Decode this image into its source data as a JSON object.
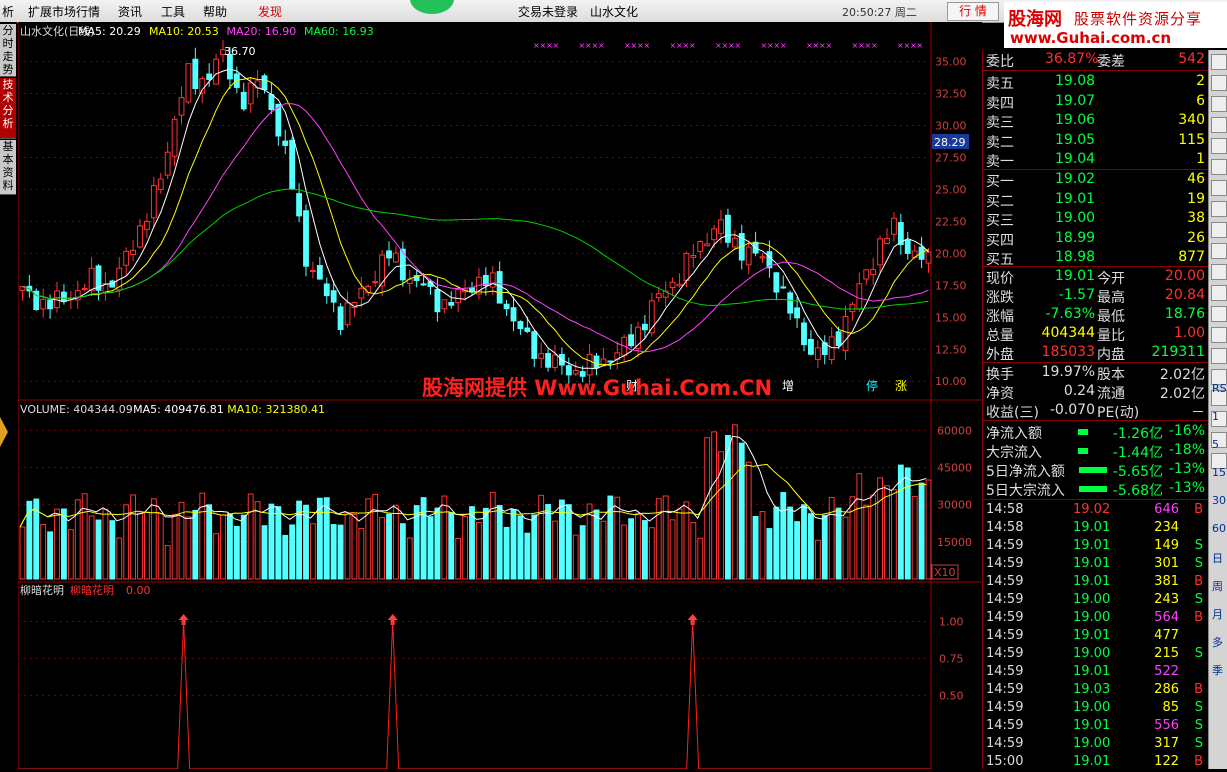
{
  "menubar": {
    "items": [
      "析",
      "扩展市场行情",
      "资讯",
      "工具",
      "帮助",
      "发现"
    ],
    "login_status": "交易未登录",
    "stock_name": "山水文化",
    "clock": "20:50:27 周二",
    "quote_button": "行 情"
  },
  "brand": {
    "site": "股海网",
    "slogan": "股票软件资源分享",
    "url": "www.Guhai.com.cn"
  },
  "left_tabs": [
    "分时走势",
    "技术分析",
    "基本资料"
  ],
  "watermark": "股海网提供 Www.Guhai.Com.CN",
  "main_chart": {
    "legend": {
      "name": "山水文化(日线)",
      "ma5": "MA5: 20.29",
      "ma10": "MA10: 20.53",
      "ma20": "MA20: 16.90",
      "ma60": "MA60: 16.93"
    },
    "y_ticks": [
      "35.00",
      "32.50",
      "30.00",
      "27.50",
      "25.00",
      "22.50",
      "20.00",
      "17.50",
      "15.00",
      "12.50",
      "10.00"
    ],
    "price_tag": "28.29",
    "peak_label": "36.70",
    "markers": [
      "财",
      "增",
      "停",
      "涨"
    ]
  },
  "volume_chart": {
    "legend": {
      "name": "VOLUME: 404344.09",
      "ma5": "MA5: 409476.81",
      "ma10": "MA10: 321380.41"
    },
    "y_ticks": [
      "60000",
      "45000",
      "30000",
      "15000"
    ],
    "unit": "X10"
  },
  "indicator_chart": {
    "legend": {
      "name": "柳暗花明",
      "sub": "柳暗花明",
      "value": "0.00"
    },
    "y_ticks": [
      "1.00",
      "0.75",
      "0.50"
    ]
  },
  "chart_data": [
    {
      "type": "candlestick",
      "title": "山水文化(日线)",
      "ylim": [
        9,
        37
      ],
      "yticks": [
        10,
        12.5,
        15,
        17.5,
        20,
        22.5,
        25,
        27.5,
        30,
        32.5,
        35
      ],
      "close_path": [
        17,
        16.5,
        16,
        16.2,
        16.8,
        17.2,
        18,
        17.5,
        18,
        20,
        22,
        24,
        26.5,
        31,
        34,
        33,
        34.5,
        35.5,
        33,
        32,
        33.5,
        32,
        29,
        25,
        20,
        18,
        16.5,
        15,
        16,
        17,
        18.5,
        20,
        19,
        18,
        17.5,
        16.5,
        16,
        16.5,
        17.5,
        18,
        17.5,
        16,
        14.5,
        13,
        12,
        11.5,
        11,
        10.8,
        11,
        11.5,
        12,
        12.5,
        13.5,
        15,
        16.5,
        17.5,
        18.5,
        20,
        21,
        22.5,
        21,
        20.5,
        20,
        19.5,
        18,
        16,
        14,
        12.5,
        12,
        13,
        15,
        17,
        19,
        21,
        22,
        20.5,
        20,
        19.2
      ]
    },
    {
      "type": "bar",
      "title": "VOLUME",
      "ylim": [
        0,
        65000
      ],
      "yticks": [
        15000,
        30000,
        45000,
        60000
      ]
    },
    {
      "type": "line",
      "title": "柳暗花明",
      "ylim": [
        0,
        1.2
      ],
      "yticks": [
        0.5,
        0.75,
        1.0
      ],
      "signal_positions": [
        0.18,
        0.41,
        0.74
      ]
    }
  ],
  "right_panel": {
    "weibi": {
      "label": "委比",
      "value": "36.87%",
      "label2": "委差",
      "value2": "542"
    },
    "sell": [
      {
        "label": "卖五",
        "price": "19.08",
        "vol": "2"
      },
      {
        "label": "卖四",
        "price": "19.07",
        "vol": "6"
      },
      {
        "label": "卖三",
        "price": "19.06",
        "vol": "340"
      },
      {
        "label": "卖二",
        "price": "19.05",
        "vol": "115"
      },
      {
        "label": "卖一",
        "price": "19.04",
        "vol": "1"
      }
    ],
    "buy": [
      {
        "label": "买一",
        "price": "19.02",
        "vol": "46"
      },
      {
        "label": "买二",
        "price": "19.01",
        "vol": "19"
      },
      {
        "label": "买三",
        "price": "19.00",
        "vol": "38"
      },
      {
        "label": "买四",
        "price": "18.99",
        "vol": "26"
      },
      {
        "label": "买五",
        "price": "18.98",
        "vol": "877"
      }
    ],
    "stats": [
      {
        "l1": "现价",
        "v1": "19.01",
        "l2": "今开",
        "v2": "20.00",
        "c1": "#00ff40",
        "c2": "#ff3030"
      },
      {
        "l1": "涨跌",
        "v1": "-1.57",
        "l2": "最高",
        "v2": "20.84",
        "c1": "#00ff40",
        "c2": "#ff3030"
      },
      {
        "l1": "涨幅",
        "v1": "-7.63%",
        "l2": "最低",
        "v2": "18.76",
        "c1": "#00ff40",
        "c2": "#00ff40"
      },
      {
        "l1": "总量",
        "v1": "404344",
        "l2": "量比",
        "v2": "1.00",
        "c1": "#ffff00",
        "c2": "#ff3030"
      },
      {
        "l1": "外盘",
        "v1": "185033",
        "l2": "内盘",
        "v2": "219311",
        "c1": "#ff3030",
        "c2": "#00ff40"
      }
    ],
    "stats2": [
      {
        "l1": "换手",
        "v1": "19.97%",
        "l2": "股本",
        "v2": "2.02亿"
      },
      {
        "l1": "净资",
        "v1": "0.24",
        "l2": "流通",
        "v2": "2.02亿"
      },
      {
        "l1": "收益(三)",
        "v1": "-0.070",
        "l2": "PE(动)",
        "v2": "－"
      }
    ],
    "flow": [
      {
        "label": "净流入额",
        "value": "-1.26亿",
        "pct": "-16%",
        "bar": 0.2
      },
      {
        "label": "大宗流入",
        "value": "-1.44亿",
        "pct": "-18%",
        "bar": 0.2
      },
      {
        "label": "5日净流入额",
        "value": "-5.65亿",
        "pct": "-13%",
        "bar": 1.0
      },
      {
        "label": "5日大宗流入",
        "value": "-5.68亿",
        "pct": "-13%",
        "bar": 1.0
      }
    ],
    "ticks": [
      {
        "t": "14:58",
        "p": "19.02",
        "v": "646",
        "d": "B",
        "pc": "#ff3030",
        "vc": "#ff40ff"
      },
      {
        "t": "14:58",
        "p": "19.01",
        "v": "234",
        "d": "",
        "pc": "#00ff40",
        "vc": "#ffff00"
      },
      {
        "t": "14:59",
        "p": "19.01",
        "v": "149",
        "d": "S",
        "pc": "#00ff40",
        "vc": "#ffff00"
      },
      {
        "t": "14:59",
        "p": "19.01",
        "v": "301",
        "d": "S",
        "pc": "#00ff40",
        "vc": "#ffff00"
      },
      {
        "t": "14:59",
        "p": "19.01",
        "v": "381",
        "d": "B",
        "pc": "#00ff40",
        "vc": "#ffff00"
      },
      {
        "t": "14:59",
        "p": "19.00",
        "v": "243",
        "d": "S",
        "pc": "#00ff40",
        "vc": "#ffff00"
      },
      {
        "t": "14:59",
        "p": "19.00",
        "v": "564",
        "d": "B",
        "pc": "#00ff40",
        "vc": "#ff40ff"
      },
      {
        "t": "14:59",
        "p": "19.01",
        "v": "477",
        "d": "",
        "pc": "#00ff40",
        "vc": "#ffff00"
      },
      {
        "t": "14:59",
        "p": "19.00",
        "v": "215",
        "d": "S",
        "pc": "#00ff40",
        "vc": "#ffff00"
      },
      {
        "t": "14:59",
        "p": "19.01",
        "v": "522",
        "d": "",
        "pc": "#00ff40",
        "vc": "#ff40ff"
      },
      {
        "t": "14:59",
        "p": "19.03",
        "v": "286",
        "d": "B",
        "pc": "#00ff40",
        "vc": "#ffff00"
      },
      {
        "t": "14:59",
        "p": "19.00",
        "v": "85",
        "d": "S",
        "pc": "#00ff40",
        "vc": "#ffff00"
      },
      {
        "t": "14:59",
        "p": "19.01",
        "v": "556",
        "d": "S",
        "pc": "#00ff40",
        "vc": "#ff40ff"
      },
      {
        "t": "14:59",
        "p": "19.00",
        "v": "317",
        "d": "S",
        "pc": "#00ff40",
        "vc": "#ffff00"
      },
      {
        "t": "15:00",
        "p": "19.01",
        "v": "122",
        "d": "B",
        "pc": "#00ff40",
        "vc": "#ffff00"
      }
    ]
  },
  "toolbar": {
    "labels": [
      "RSI",
      "1",
      "5",
      "15",
      "30",
      "60",
      "日",
      "周",
      "月",
      "多",
      "季"
    ]
  }
}
